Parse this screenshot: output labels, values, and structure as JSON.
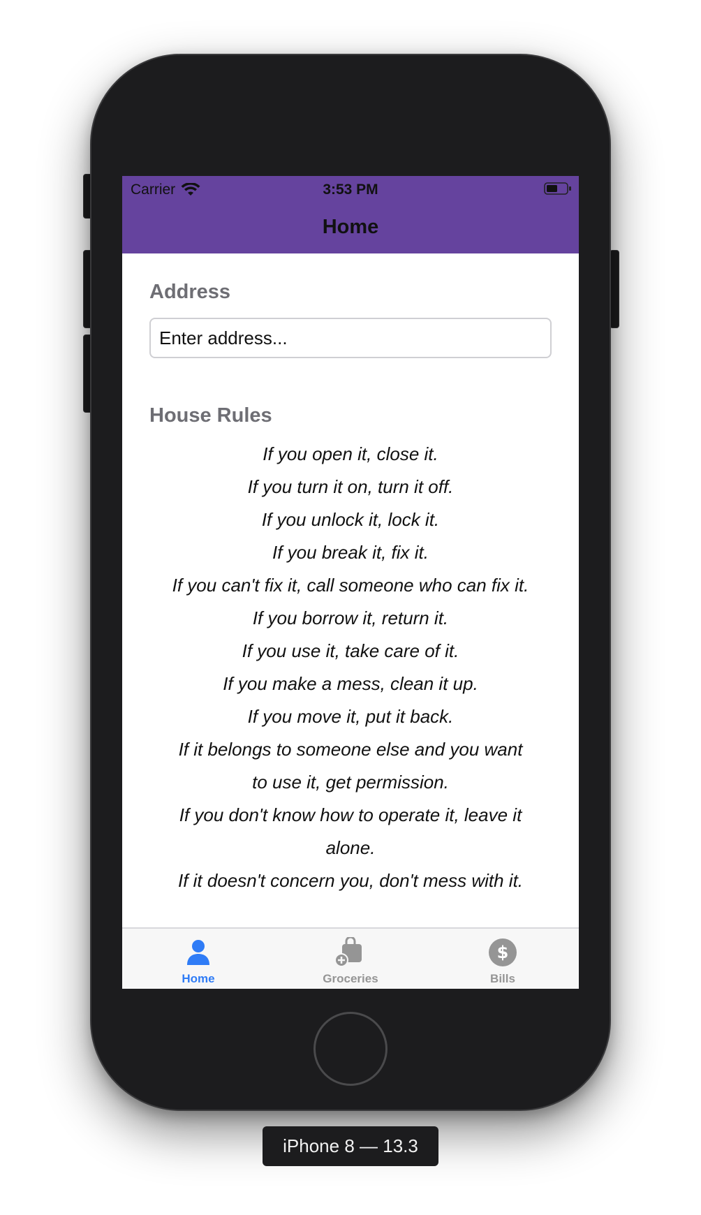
{
  "status_bar": {
    "carrier": "Carrier",
    "time": "3:53 PM"
  },
  "nav": {
    "title": "Home",
    "color": "#65439e"
  },
  "address": {
    "label": "Address",
    "placeholder": "Enter address..."
  },
  "house_rules": {
    "label": "House Rules",
    "lines": [
      "If you open it, close it.",
      "If you turn it on, turn it off.",
      "If you unlock it, lock it.",
      "If you break it, fix it.",
      "If you can't fix it, call someone who can fix it.",
      "If you borrow it, return it.",
      "If you use it, take care of it.",
      "If you make a mess, clean it up.",
      "If you move it, put it back.",
      "If it belongs to someone else and you want",
      "to use it, get permission.",
      "If you don't know how to operate it, leave it",
      "alone.",
      "If it doesn't concern you, don't mess with it."
    ]
  },
  "tabbar": {
    "items": [
      {
        "label": "Home",
        "icon": "person-icon",
        "selected": true
      },
      {
        "label": "Groceries",
        "icon": "bag-add-icon",
        "selected": false
      },
      {
        "label": "Bills",
        "icon": "dollar-circle-icon",
        "selected": false
      }
    ],
    "active_color": "#2f7cf6",
    "inactive_color": "#959595"
  },
  "device": {
    "label": "iPhone 8 — 13.3"
  }
}
